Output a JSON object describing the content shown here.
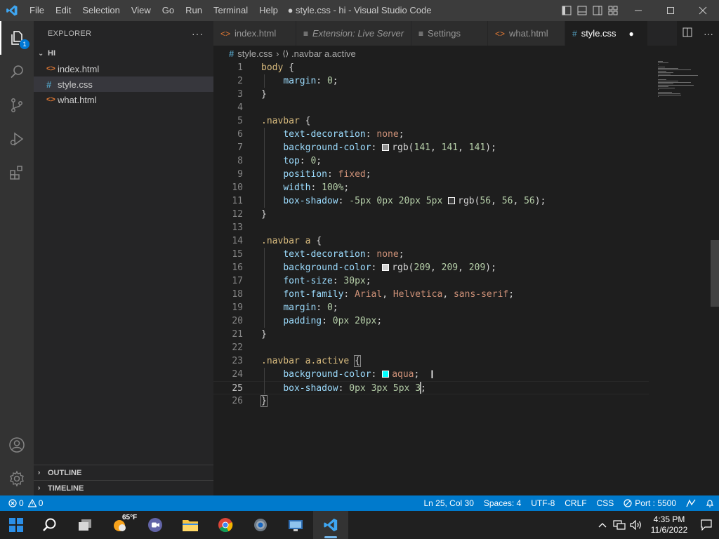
{
  "window": {
    "title": "● style.css - hi - Visual Studio Code",
    "menu": [
      "File",
      "Edit",
      "Selection",
      "View",
      "Go",
      "Run",
      "Terminal",
      "Help"
    ]
  },
  "activity": {
    "explorer_badge": "1"
  },
  "sidebar": {
    "header": "EXPLORER",
    "more": "···",
    "folder": "HI",
    "files": [
      {
        "name": "index.html",
        "type": "html"
      },
      {
        "name": "style.css",
        "type": "css",
        "selected": true
      },
      {
        "name": "what.html",
        "type": "html"
      }
    ],
    "outline": "OUTLINE",
    "timeline": "TIMELINE"
  },
  "tabs": [
    {
      "label": "index.html",
      "icon": "<>"
    },
    {
      "label": "Extension: Live Server",
      "icon": "≡"
    },
    {
      "label": "Settings",
      "icon": "≡"
    },
    {
      "label": "what.html",
      "icon": "<>"
    },
    {
      "label": "style.css",
      "icon": "#",
      "active": true,
      "dirty": "●"
    }
  ],
  "breadcrumb": {
    "file": "style.css",
    "symbol": ".navbar a.active"
  },
  "editor": {
    "current_line": 25,
    "lines": [
      {
        "n": "1",
        "tokens": [
          [
            "sel",
            "body"
          ],
          [
            "p",
            " {"
          ]
        ]
      },
      {
        "n": "2",
        "tokens": [
          [
            "p",
            "    "
          ],
          [
            "prop",
            "margin"
          ],
          [
            "p",
            ": "
          ],
          [
            "num",
            "0"
          ],
          [
            "p",
            ";"
          ]
        ]
      },
      {
        "n": "3",
        "tokens": [
          [
            "p",
            "}"
          ]
        ]
      },
      {
        "n": "4",
        "tokens": []
      },
      {
        "n": "5",
        "tokens": [
          [
            "sel",
            ".navbar"
          ],
          [
            "p",
            " {"
          ]
        ]
      },
      {
        "n": "6",
        "tokens": [
          [
            "p",
            "    "
          ],
          [
            "prop",
            "text-decoration"
          ],
          [
            "p",
            ": "
          ],
          [
            "val",
            "none"
          ],
          [
            "p",
            ";"
          ]
        ]
      },
      {
        "n": "7",
        "tokens": [
          [
            "p",
            "    "
          ],
          [
            "prop",
            "background-color"
          ],
          [
            "p",
            ": "
          ],
          [
            "swatch",
            "#8d8d8d"
          ],
          [
            "p",
            "rgb("
          ],
          [
            "num",
            "141"
          ],
          [
            "p",
            ", "
          ],
          [
            "num",
            "141"
          ],
          [
            "p",
            ", "
          ],
          [
            "num",
            "141"
          ],
          [
            "p",
            ");"
          ]
        ]
      },
      {
        "n": "8",
        "tokens": [
          [
            "p",
            "    "
          ],
          [
            "prop",
            "top"
          ],
          [
            "p",
            ": "
          ],
          [
            "num",
            "0"
          ],
          [
            "p",
            ";"
          ]
        ]
      },
      {
        "n": "9",
        "tokens": [
          [
            "p",
            "    "
          ],
          [
            "prop",
            "position"
          ],
          [
            "p",
            ": "
          ],
          [
            "val",
            "fixed"
          ],
          [
            "p",
            ";"
          ]
        ]
      },
      {
        "n": "10",
        "tokens": [
          [
            "p",
            "    "
          ],
          [
            "prop",
            "width"
          ],
          [
            "p",
            ": "
          ],
          [
            "num",
            "100%"
          ],
          [
            "p",
            ";"
          ]
        ]
      },
      {
        "n": "11",
        "tokens": [
          [
            "p",
            "    "
          ],
          [
            "prop",
            "box-shadow"
          ],
          [
            "p",
            ": "
          ],
          [
            "num",
            "-5px"
          ],
          [
            "p",
            " "
          ],
          [
            "num",
            "0px"
          ],
          [
            "p",
            " "
          ],
          [
            "num",
            "20px"
          ],
          [
            "p",
            " "
          ],
          [
            "num",
            "5px"
          ],
          [
            "p",
            " "
          ],
          [
            "swatch",
            "#383838"
          ],
          [
            "p",
            "rgb("
          ],
          [
            "num",
            "56"
          ],
          [
            "p",
            ", "
          ],
          [
            "num",
            "56"
          ],
          [
            "p",
            ", "
          ],
          [
            "num",
            "56"
          ],
          [
            "p",
            ");"
          ]
        ]
      },
      {
        "n": "12",
        "tokens": [
          [
            "p",
            "}"
          ]
        ]
      },
      {
        "n": "13",
        "tokens": []
      },
      {
        "n": "14",
        "tokens": [
          [
            "sel",
            ".navbar a"
          ],
          [
            "p",
            " {"
          ]
        ]
      },
      {
        "n": "15",
        "tokens": [
          [
            "p",
            "    "
          ],
          [
            "prop",
            "text-decoration"
          ],
          [
            "p",
            ": "
          ],
          [
            "val",
            "none"
          ],
          [
            "p",
            ";"
          ]
        ]
      },
      {
        "n": "16",
        "tokens": [
          [
            "p",
            "    "
          ],
          [
            "prop",
            "background-color"
          ],
          [
            "p",
            ": "
          ],
          [
            "swatch",
            "#d1d1d1"
          ],
          [
            "p",
            "rgb("
          ],
          [
            "num",
            "209"
          ],
          [
            "p",
            ", "
          ],
          [
            "num",
            "209"
          ],
          [
            "p",
            ", "
          ],
          [
            "num",
            "209"
          ],
          [
            "p",
            ");"
          ]
        ]
      },
      {
        "n": "17",
        "tokens": [
          [
            "p",
            "    "
          ],
          [
            "prop",
            "font-size"
          ],
          [
            "p",
            ": "
          ],
          [
            "num",
            "30px"
          ],
          [
            "p",
            ";"
          ]
        ]
      },
      {
        "n": "18",
        "tokens": [
          [
            "p",
            "    "
          ],
          [
            "prop",
            "font-family"
          ],
          [
            "p",
            ": "
          ],
          [
            "val",
            "Arial"
          ],
          [
            "p",
            ", "
          ],
          [
            "val",
            "Helvetica"
          ],
          [
            "p",
            ", "
          ],
          [
            "val",
            "sans-serif"
          ],
          [
            "p",
            ";"
          ]
        ]
      },
      {
        "n": "19",
        "tokens": [
          [
            "p",
            "    "
          ],
          [
            "prop",
            "margin"
          ],
          [
            "p",
            ": "
          ],
          [
            "num",
            "0"
          ],
          [
            "p",
            ";"
          ]
        ]
      },
      {
        "n": "20",
        "tokens": [
          [
            "p",
            "    "
          ],
          [
            "prop",
            "padding"
          ],
          [
            "p",
            ": "
          ],
          [
            "num",
            "0px"
          ],
          [
            "p",
            " "
          ],
          [
            "num",
            "20px"
          ],
          [
            "p",
            ";"
          ]
        ]
      },
      {
        "n": "21",
        "tokens": [
          [
            "p",
            "}"
          ]
        ]
      },
      {
        "n": "22",
        "tokens": []
      },
      {
        "n": "23",
        "tokens": [
          [
            "sel",
            ".navbar a.active"
          ],
          [
            "p",
            " "
          ],
          [
            "match",
            "{"
          ]
        ]
      },
      {
        "n": "24",
        "tokens": [
          [
            "p",
            "    "
          ],
          [
            "prop",
            "background-color"
          ],
          [
            "p",
            ": "
          ],
          [
            "swatch",
            "#00ffff"
          ],
          [
            "val",
            "aqua"
          ],
          [
            "p",
            ";"
          ]
        ]
      },
      {
        "n": "25",
        "tokens": [
          [
            "p",
            "    "
          ],
          [
            "prop",
            "box-shadow"
          ],
          [
            "p",
            ": "
          ],
          [
            "num",
            "0px"
          ],
          [
            "p",
            " "
          ],
          [
            "num",
            "3px"
          ],
          [
            "p",
            " "
          ],
          [
            "num",
            "5px"
          ],
          [
            "p",
            " "
          ],
          [
            "num",
            "3"
          ],
          [
            "p",
            ";"
          ]
        ]
      },
      {
        "n": "26",
        "tokens": [
          [
            "match",
            "}"
          ]
        ]
      }
    ]
  },
  "status": {
    "errors": "0",
    "warnings": "0",
    "position": "Ln 25, Col 30",
    "spaces": "Spaces: 4",
    "encoding": "UTF-8",
    "eol": "CRLF",
    "language": "CSS",
    "port": "Port : 5500"
  },
  "taskbar": {
    "weather": "65°F",
    "time": "4:35 PM",
    "date": "11/6/2022"
  },
  "colors": {
    "titlebar": "#3c3c3c",
    "activitybar": "#333333",
    "sidebar": "#252526",
    "editor": "#1e1e1e",
    "statusbar": "#007acc",
    "taskbar": "#202020",
    "accent": "#0078d4"
  }
}
